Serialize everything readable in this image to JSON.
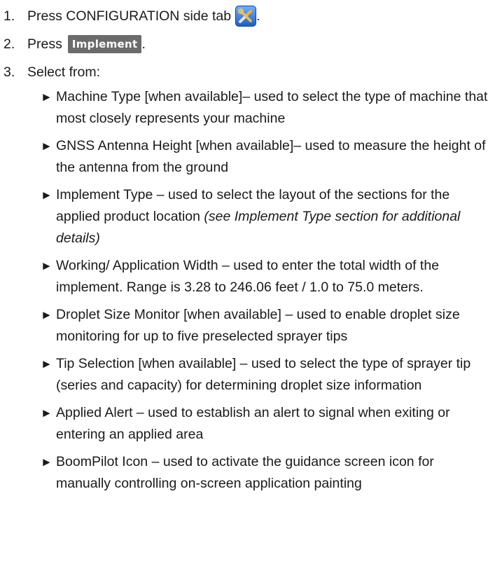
{
  "steps": [
    {
      "num": "1.",
      "text": "Press CONFIGURATION side tab",
      "suffix": ".",
      "icon": "configuration-tools-icon"
    },
    {
      "num": "2.",
      "text": "Press",
      "button": "Implement",
      "suffix": "."
    },
    {
      "num": "3.",
      "text": "Select from:"
    }
  ],
  "arrow": "►",
  "options": [
    {
      "text": "Machine Type [when available]– used to select the type of machine that most closely represents your machine",
      "note": ""
    },
    {
      "text": "GNSS Antenna Height [when available]– used to measure the height of the antenna from the ground",
      "note": ""
    },
    {
      "text": "Implement Type – used to select the layout of the sections for the applied product location ",
      "note": "(see Implement Type section for additional details)"
    },
    {
      "text": "Working/ Application Width – used to enter the total width of the implement. Range is 3.28 to 246.06 feet / 1.0 to 75.0 meters.",
      "note": ""
    },
    {
      "text": "Droplet Size Monitor [when available] – used to enable droplet size monitoring for up to five preselected sprayer tips",
      "note": ""
    },
    {
      "text": "Tip Selection [when available] – used to select the type of sprayer tip (series and capacity) for determining droplet size information",
      "note": ""
    },
    {
      "text": "Applied Alert – used to establish an alert to signal when exiting or entering an applied area",
      "note": ""
    },
    {
      "text": "BoomPilot Icon – used to activate the guidance screen icon for manually controlling on-screen application painting",
      "note": ""
    }
  ]
}
